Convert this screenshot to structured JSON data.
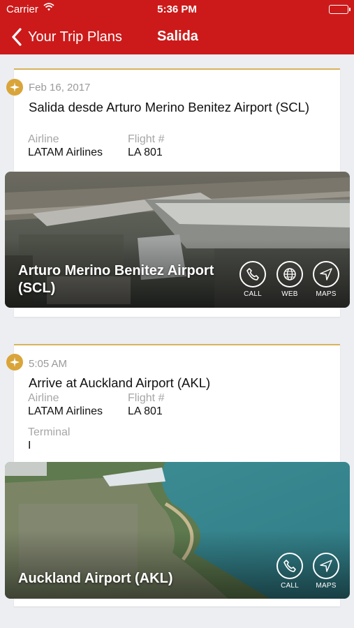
{
  "status_bar": {
    "carrier": "Carrier",
    "time": "5:36 PM"
  },
  "nav": {
    "back_label": "Your Trip Plans",
    "title": "Salida"
  },
  "colors": {
    "brand_red": "#cc1a1a",
    "badge_gold": "#d9a53a",
    "card_accent": "#d9b25a"
  },
  "cards": [
    {
      "date": "Feb 16, 2017",
      "heading": "Salida desde Arturo Merino Benitez Airport (SCL)",
      "airline_label": "Airline",
      "airline_value": "LATAM Airlines",
      "flight_label": "Flight #",
      "flight_value": "LA 801",
      "icon": "plane-icon",
      "photo_title": "Arturo Merino Benitez Airport (SCL)",
      "actions": {
        "call": "CALL",
        "web": "WEB",
        "maps": "MAPS"
      }
    },
    {
      "date": "5:05 AM",
      "heading": "Arrive at Auckland Airport (AKL)",
      "airline_label": "Airline",
      "airline_value": "LATAM Airlines",
      "flight_label": "Flight #",
      "flight_value": "LA 801",
      "terminal_label": "Terminal",
      "terminal_value": "I",
      "icon": "plane-icon",
      "photo_title": "Auckland Airport (AKL)",
      "actions": {
        "call": "CALL",
        "maps": "MAPS"
      }
    }
  ]
}
